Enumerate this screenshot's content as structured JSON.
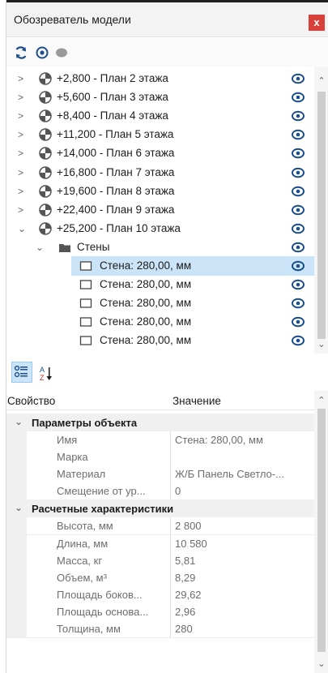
{
  "window": {
    "title": "Обозреватель модели",
    "close_label": "x"
  },
  "toolbar": {
    "refresh_icon": "refresh-icon",
    "show_icon": "eye-icon",
    "hide_icon": "hidden-eye-icon"
  },
  "tree": {
    "rows": [
      {
        "label": "+2,800 - План 2 этажа",
        "chevron": ">"
      },
      {
        "label": "+5,600 - План 3 этажа",
        "chevron": ">"
      },
      {
        "label": "+8,400 - План 4 этажа",
        "chevron": ">"
      },
      {
        "label": "+11,200 - План 5 этажа",
        "chevron": ">"
      },
      {
        "label": "+14,000 - План 6 этажа",
        "chevron": ">"
      },
      {
        "label": "+16,800 - План 7 этажа",
        "chevron": ">"
      },
      {
        "label": "+19,600 - План 8 этажа",
        "chevron": ">"
      },
      {
        "label": "+22,400 - План 9 этажа",
        "chevron": ">"
      },
      {
        "label": "+25,200 - План 10 этажа",
        "chevron": "⌄"
      }
    ],
    "group": {
      "label": "Стены",
      "chevron": "⌄"
    },
    "items": [
      {
        "label": "Стена: 280,00, мм",
        "selected": true
      },
      {
        "label": "Стена: 280,00, мм",
        "selected": false
      },
      {
        "label": "Стена: 280,00, мм",
        "selected": false
      },
      {
        "label": "Стена: 280,00, мм",
        "selected": false
      },
      {
        "label": "Стена: 280,00, мм",
        "selected": false
      }
    ]
  },
  "properties": {
    "header": {
      "property": "Свойство",
      "value": "Значение"
    },
    "categories": [
      {
        "label": "Параметры объекта",
        "rows": [
          {
            "name": "Имя",
            "value": "Стена: 280,00, мм"
          },
          {
            "name": "Марка",
            "value": ""
          },
          {
            "name": "Материал",
            "value": "Ж/Б Панель Светло-..."
          },
          {
            "name": "Смещение от ур...",
            "value": "0"
          }
        ]
      },
      {
        "label": "Расчетные характеристики",
        "rows": [
          {
            "name": "Высота, мм",
            "value": "2 800"
          },
          {
            "name": "Длина, мм",
            "value": "10 580"
          },
          {
            "name": "Масса, кг",
            "value": "5,81"
          },
          {
            "name": "Объем, м³",
            "value": "8,29"
          },
          {
            "name": "Площадь боков...",
            "value": "29,62"
          },
          {
            "name": "Площадь основа...",
            "value": "2,96"
          },
          {
            "name": "Толщина, мм",
            "value": "280"
          }
        ]
      }
    ]
  },
  "colors": {
    "accent": "#1f74bf",
    "selection": "#cce4f7",
    "close": "#d9403a"
  }
}
